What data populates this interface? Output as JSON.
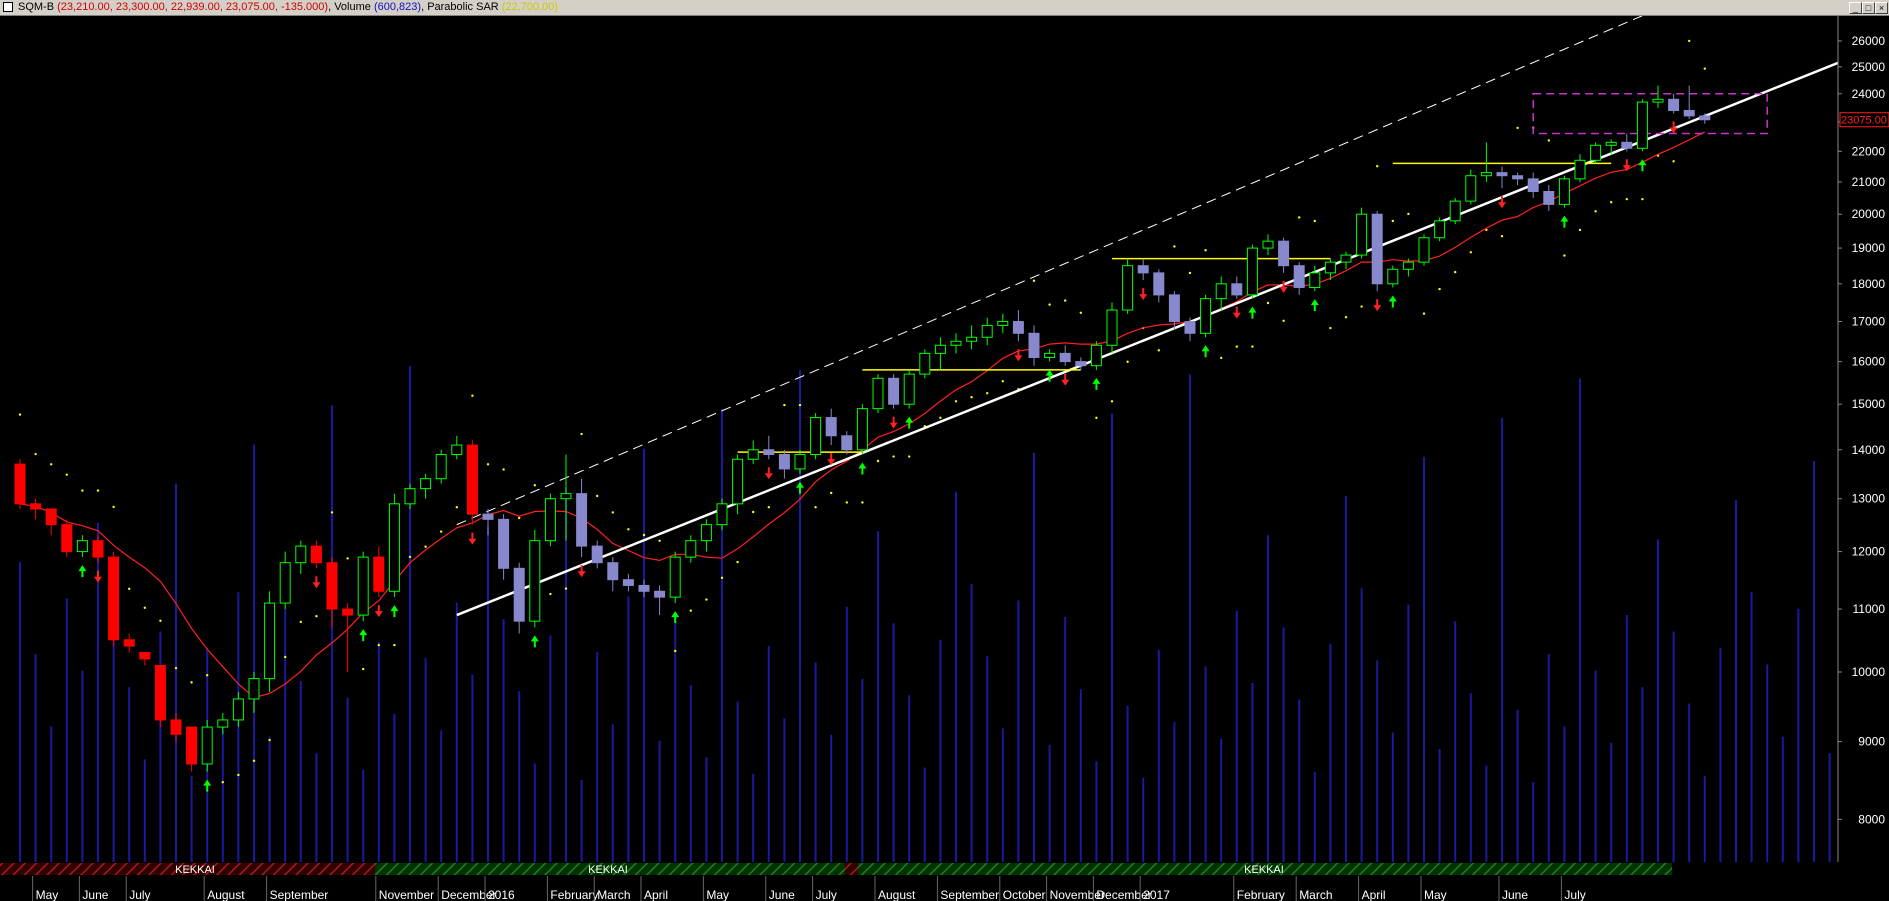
{
  "header": {
    "symbol": "SQM-B",
    "ohlc": "(23,210.00, 23,300.00, 22,939.00, 23,075.00, -135.000)",
    "volume_label": "Volume",
    "volume_value": "(600,823)",
    "sar_label": "Parabolic SAR",
    "sar_value": "(22,700.00)"
  },
  "window_buttons": [
    "_",
    "□",
    "×"
  ],
  "colors": {
    "bull_candle": "#00ff00",
    "bear_candle": "#ff0000",
    "gray_candle": "#8888cc",
    "volume": "#1a1aa0",
    "moving_average": "#ff2020",
    "sar": "#ffff00",
    "trendline": "#ffffff",
    "channel": "#ffffff",
    "resistance": "#ffff00",
    "range_box": "#cc33cc"
  },
  "chart_data": {
    "type": "candlestick",
    "y_axis": {
      "scale": "log",
      "ticks": [
        8000,
        9000,
        10000,
        11000,
        12000,
        13000,
        14000,
        15000,
        16000,
        17000,
        18000,
        19000,
        20000,
        21000,
        22000,
        23000,
        24000,
        25000,
        26000
      ],
      "last_price_label": "23075.00"
    },
    "x_axis": {
      "labels": [
        "May",
        "June",
        "July",
        "August",
        "September",
        "November",
        "December",
        "2016",
        "February",
        "March",
        "April",
        "May",
        "June",
        "July",
        "August",
        "September",
        "October",
        "November",
        "December",
        "2017",
        "February",
        "March",
        "April",
        "May",
        "June",
        "July"
      ]
    },
    "candles": [
      {
        "o": 13700,
        "h": 13800,
        "l": 12800,
        "c": 12900
      },
      {
        "o": 12900,
        "h": 13000,
        "l": 12600,
        "c": 12800
      },
      {
        "o": 12800,
        "h": 12800,
        "l": 12300,
        "c": 12500
      },
      {
        "o": 12500,
        "h": 12600,
        "l": 11900,
        "c": 12000
      },
      {
        "o": 12000,
        "h": 12300,
        "l": 11900,
        "c": 12200
      },
      {
        "o": 12200,
        "h": 12300,
        "l": 11800,
        "c": 11900
      },
      {
        "o": 11900,
        "h": 12000,
        "l": 10400,
        "c": 10500
      },
      {
        "o": 10500,
        "h": 10600,
        "l": 10300,
        "c": 10400
      },
      {
        "o": 10300,
        "h": 10300,
        "l": 10100,
        "c": 10200
      },
      {
        "o": 10100,
        "h": 10100,
        "l": 9200,
        "c": 9300
      },
      {
        "o": 9300,
        "h": 9400,
        "l": 9000,
        "c": 9100
      },
      {
        "o": 9200,
        "h": 9200,
        "l": 8600,
        "c": 8700
      },
      {
        "o": 8700,
        "h": 9300,
        "l": 8600,
        "c": 9200
      },
      {
        "o": 9200,
        "h": 9400,
        "l": 9100,
        "c": 9300
      },
      {
        "o": 9300,
        "h": 9700,
        "l": 9200,
        "c": 9600
      },
      {
        "o": 9600,
        "h": 10000,
        "l": 9400,
        "c": 9900
      },
      {
        "o": 9900,
        "h": 11300,
        "l": 9700,
        "c": 11100
      },
      {
        "o": 11100,
        "h": 12000,
        "l": 11000,
        "c": 11800
      },
      {
        "o": 11800,
        "h": 12200,
        "l": 11600,
        "c": 12100
      },
      {
        "o": 12100,
        "h": 12200,
        "l": 11700,
        "c": 11800
      },
      {
        "o": 11800,
        "h": 11900,
        "l": 10700,
        "c": 11000
      },
      {
        "o": 11000,
        "h": 11100,
        "l": 10000,
        "c": 10900
      },
      {
        "o": 10900,
        "h": 12000,
        "l": 10800,
        "c": 11900
      },
      {
        "o": 11900,
        "h": 12100,
        "l": 11200,
        "c": 11300
      },
      {
        "o": 11300,
        "h": 13100,
        "l": 11200,
        "c": 12900
      },
      {
        "o": 12900,
        "h": 13300,
        "l": 12800,
        "c": 13200
      },
      {
        "o": 13200,
        "h": 13500,
        "l": 13000,
        "c": 13400
      },
      {
        "o": 13400,
        "h": 14000,
        "l": 13300,
        "c": 13900
      },
      {
        "o": 13900,
        "h": 14300,
        "l": 13800,
        "c": 14100
      },
      {
        "o": 14100,
        "h": 14200,
        "l": 12500,
        "c": 12700
      },
      {
        "o": 12700,
        "h": 12800,
        "l": 12300,
        "c": 12600
      },
      {
        "o": 12600,
        "h": 12700,
        "l": 11500,
        "c": 11700
      },
      {
        "o": 11700,
        "h": 11800,
        "l": 10600,
        "c": 10800
      },
      {
        "o": 10800,
        "h": 12400,
        "l": 10700,
        "c": 12200
      },
      {
        "o": 12200,
        "h": 13100,
        "l": 12100,
        "c": 13000
      },
      {
        "o": 13000,
        "h": 13900,
        "l": 12200,
        "c": 13100
      },
      {
        "o": 13100,
        "h": 13400,
        "l": 11900,
        "c": 12100
      },
      {
        "o": 12100,
        "h": 12200,
        "l": 11700,
        "c": 11800
      },
      {
        "o": 11800,
        "h": 11900,
        "l": 11300,
        "c": 11500
      },
      {
        "o": 11500,
        "h": 11600,
        "l": 11300,
        "c": 11400
      },
      {
        "o": 11400,
        "h": 11500,
        "l": 11200,
        "c": 11300
      },
      {
        "o": 11300,
        "h": 11400,
        "l": 10900,
        "c": 11200
      },
      {
        "o": 11200,
        "h": 12000,
        "l": 11100,
        "c": 11900
      },
      {
        "o": 11900,
        "h": 12300,
        "l": 11800,
        "c": 12200
      },
      {
        "o": 12200,
        "h": 12600,
        "l": 12000,
        "c": 12500
      },
      {
        "o": 12500,
        "h": 13000,
        "l": 12400,
        "c": 12900
      },
      {
        "o": 12900,
        "h": 13900,
        "l": 12700,
        "c": 13800
      },
      {
        "o": 13800,
        "h": 14200,
        "l": 13700,
        "c": 14000
      },
      {
        "o": 14000,
        "h": 14300,
        "l": 13800,
        "c": 13900
      },
      {
        "o": 13900,
        "h": 14000,
        "l": 13400,
        "c": 13600
      },
      {
        "o": 13600,
        "h": 14000,
        "l": 13500,
        "c": 13900
      },
      {
        "o": 13900,
        "h": 14800,
        "l": 13800,
        "c": 14700
      },
      {
        "o": 14700,
        "h": 14900,
        "l": 14100,
        "c": 14300
      },
      {
        "o": 14300,
        "h": 14400,
        "l": 13900,
        "c": 14000
      },
      {
        "o": 14000,
        "h": 15000,
        "l": 13900,
        "c": 14900
      },
      {
        "o": 14900,
        "h": 15700,
        "l": 14800,
        "c": 15600
      },
      {
        "o": 15600,
        "h": 15700,
        "l": 14900,
        "c": 15000
      },
      {
        "o": 15000,
        "h": 15800,
        "l": 14900,
        "c": 15700
      },
      {
        "o": 15700,
        "h": 16300,
        "l": 15600,
        "c": 16200
      },
      {
        "o": 16200,
        "h": 16600,
        "l": 15800,
        "c": 16400
      },
      {
        "o": 16400,
        "h": 16700,
        "l": 16200,
        "c": 16500
      },
      {
        "o": 16500,
        "h": 16900,
        "l": 16300,
        "c": 16600
      },
      {
        "o": 16600,
        "h": 17100,
        "l": 16400,
        "c": 16900
      },
      {
        "o": 16900,
        "h": 17200,
        "l": 16700,
        "c": 17000
      },
      {
        "o": 17000,
        "h": 17300,
        "l": 16500,
        "c": 16700
      },
      {
        "o": 16700,
        "h": 16900,
        "l": 15900,
        "c": 16100
      },
      {
        "o": 16100,
        "h": 16300,
        "l": 16000,
        "c": 16200
      },
      {
        "o": 16200,
        "h": 16400,
        "l": 15900,
        "c": 16000
      },
      {
        "o": 16000,
        "h": 16100,
        "l": 15800,
        "c": 15900
      },
      {
        "o": 15900,
        "h": 16500,
        "l": 15800,
        "c": 16400
      },
      {
        "o": 16400,
        "h": 17500,
        "l": 16200,
        "c": 17300
      },
      {
        "o": 17300,
        "h": 18700,
        "l": 17200,
        "c": 18500
      },
      {
        "o": 18500,
        "h": 18700,
        "l": 18100,
        "c": 18300
      },
      {
        "o": 18300,
        "h": 18400,
        "l": 17500,
        "c": 17700
      },
      {
        "o": 17700,
        "h": 17800,
        "l": 16800,
        "c": 17000
      },
      {
        "o": 17000,
        "h": 17100,
        "l": 16500,
        "c": 16700
      },
      {
        "o": 16700,
        "h": 17700,
        "l": 16600,
        "c": 17600
      },
      {
        "o": 17600,
        "h": 18200,
        "l": 17300,
        "c": 18000
      },
      {
        "o": 18000,
        "h": 18200,
        "l": 17600,
        "c": 17700
      },
      {
        "o": 17700,
        "h": 19100,
        "l": 17600,
        "c": 19000
      },
      {
        "o": 19000,
        "h": 19400,
        "l": 18800,
        "c": 19200
      },
      {
        "o": 19200,
        "h": 19300,
        "l": 18300,
        "c": 18500
      },
      {
        "o": 18500,
        "h": 18600,
        "l": 17700,
        "c": 17900
      },
      {
        "o": 17900,
        "h": 18500,
        "l": 17800,
        "c": 18300
      },
      {
        "o": 18300,
        "h": 18700,
        "l": 18100,
        "c": 18600
      },
      {
        "o": 18600,
        "h": 18900,
        "l": 18400,
        "c": 18800
      },
      {
        "o": 18800,
        "h": 20200,
        "l": 18700,
        "c": 20000
      },
      {
        "o": 20000,
        "h": 20100,
        "l": 17800,
        "c": 18000
      },
      {
        "o": 18000,
        "h": 18500,
        "l": 17900,
        "c": 18400
      },
      {
        "o": 18400,
        "h": 18700,
        "l": 18200,
        "c": 18600
      },
      {
        "o": 18600,
        "h": 19400,
        "l": 18500,
        "c": 19300
      },
      {
        "o": 19300,
        "h": 19900,
        "l": 19200,
        "c": 19800
      },
      {
        "o": 19800,
        "h": 20500,
        "l": 19700,
        "c": 20400
      },
      {
        "o": 20400,
        "h": 21400,
        "l": 20300,
        "c": 21200
      },
      {
        "o": 21200,
        "h": 22300,
        "l": 21000,
        "c": 21300
      },
      {
        "o": 21300,
        "h": 21500,
        "l": 20800,
        "c": 21200
      },
      {
        "o": 21200,
        "h": 21300,
        "l": 20900,
        "c": 21100
      },
      {
        "o": 21100,
        "h": 21300,
        "l": 20500,
        "c": 20700
      },
      {
        "o": 20700,
        "h": 20900,
        "l": 20100,
        "c": 20300
      },
      {
        "o": 20300,
        "h": 21200,
        "l": 20200,
        "c": 21100
      },
      {
        "o": 21100,
        "h": 21900,
        "l": 21000,
        "c": 21700
      },
      {
        "o": 21700,
        "h": 22300,
        "l": 21600,
        "c": 22200
      },
      {
        "o": 22200,
        "h": 22400,
        "l": 21900,
        "c": 22300
      },
      {
        "o": 22300,
        "h": 22600,
        "l": 22000,
        "c": 22100
      },
      {
        "o": 22100,
        "h": 23800,
        "l": 22000,
        "c": 23700
      },
      {
        "o": 23700,
        "h": 24300,
        "l": 23500,
        "c": 23800
      },
      {
        "o": 23800,
        "h": 24000,
        "l": 23300,
        "c": 23400
      },
      {
        "o": 23400,
        "h": 24300,
        "l": 23100,
        "c": 23210
      },
      {
        "o": 23210,
        "h": 23300,
        "l": 22939,
        "c": 23075
      }
    ],
    "kekkai_labels": [
      "KEKKAI",
      "KEKKAI",
      "KEKKAI"
    ]
  }
}
